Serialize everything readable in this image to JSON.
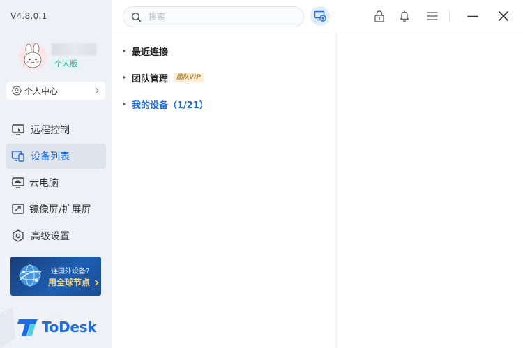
{
  "app": {
    "version": "V4.8.0.1",
    "edition": "个人版",
    "brand_name": "ToDesk"
  },
  "profile": {
    "center_label": "个人中心"
  },
  "nav": {
    "items": [
      {
        "label": "远程控制",
        "icon": "remote-control-icon"
      },
      {
        "label": "设备列表",
        "icon": "device-list-icon",
        "active": true
      },
      {
        "label": "云电脑",
        "icon": "cloud-pc-icon"
      },
      {
        "label": "镜像屏/扩展屏",
        "icon": "mirror-screen-icon"
      },
      {
        "label": "高级设置",
        "icon": "settings-hex-icon"
      }
    ]
  },
  "promo": {
    "line1": "连国外设备?",
    "line2": "用全球节点"
  },
  "search": {
    "placeholder": "搜索"
  },
  "toolbar": {
    "icons": [
      "add-device-icon",
      "lock-icon",
      "bell-icon",
      "menu-icon",
      "minimize-icon",
      "close-icon"
    ]
  },
  "groups": {
    "recent": "最近连接",
    "team": "团队管理",
    "team_badge": "团队VIP",
    "mine": "我的设备（1/21）"
  },
  "colors": {
    "accent": "#1a6de6",
    "sidebar_bg": "#eef2f7",
    "edition_text": "#1eb7a6",
    "vip_text": "#b7863a"
  }
}
